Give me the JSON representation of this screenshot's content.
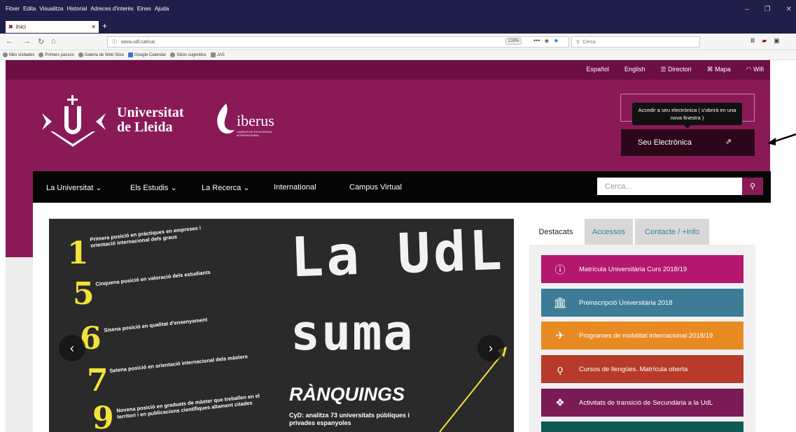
{
  "browser": {
    "menu": [
      "Fitxer",
      "Edita",
      "Visualitza",
      "Historial",
      "Adreces d'interès",
      "Eines",
      "Ajuda"
    ],
    "tab_title": "Inici",
    "url": "www.udl.cat/ca/",
    "zoom": "133%",
    "search_placeholder": "Cerca",
    "bookmarks": [
      "Més visitades",
      "Primers passos",
      "Galeria de Web Slice",
      "Google Calendar",
      "Sitios sugeridos",
      "JAS"
    ]
  },
  "site": {
    "top_links": [
      "Español",
      "English",
      "Directori",
      "Mapa",
      "Wifi"
    ],
    "logo": {
      "line1": "Universitat",
      "line2": "de Lleida"
    },
    "iberus": {
      "name": "iberus",
      "subtitle": "CAMPUS DE EXCELENCIA INTERNACIONAL"
    },
    "tooltip": "Accedir a seu electrònica ( s'obrirà en una nova finestra )",
    "seu_button": "Seu Electrònica",
    "nav": [
      "La Universitat",
      "Els Estudis",
      "La Recerca",
      "International",
      "Campus Virtual"
    ],
    "search_placeholder": "Cerca..."
  },
  "slide": {
    "rankings": [
      {
        "num": "1",
        "text": "Primera posició en pràctiques en empreses i orientació internacional dels graus"
      },
      {
        "num": "5",
        "text": "Cinquena posició en valoració dels estudiants"
      },
      {
        "num": "6",
        "text": "Sisena posició en qualitat d'ensenyament"
      },
      {
        "num": "7",
        "text": "Setena posició en orientació internacional dels màsters"
      },
      {
        "num": "9",
        "text": "Novena posició en graduats de màster que treballen en el territori i en publicacions científiques altament citades"
      }
    ],
    "title_line1": "La UdL",
    "title_line2": "suma",
    "subtitle": "RÀNQUINGS",
    "caption": "CyD: analitza 73 universitats públiques i privades espanyoles"
  },
  "side_tabs": [
    "Destacats",
    "Accessos",
    "Contacte / +Info"
  ],
  "highlights": [
    {
      "label": "Matrícula Universitària Curs 2018/19",
      "icon": "info-icon",
      "color": "#b3186e"
    },
    {
      "label": "Preinscripció Universitària 2018",
      "icon": "bank-icon",
      "color": "#3c7c96"
    },
    {
      "label": "Programes de mobilitat internacional 2018/19",
      "icon": "plane-icon",
      "color": "#e88a22"
    },
    {
      "label": "Cursos de llengües. Matrícula oberta",
      "icon": "language-icon",
      "color": "#b73a2a"
    },
    {
      "label": "Activitats de transició de Secundària a la UdL",
      "icon": "cubes-icon",
      "color": "#7b1b55"
    }
  ]
}
